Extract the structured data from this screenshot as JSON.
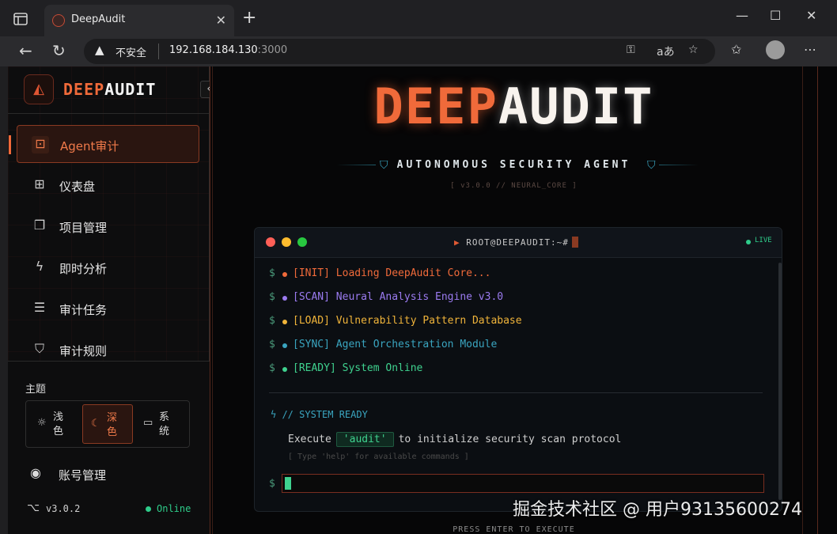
{
  "browser": {
    "tab_title": "DeepAudit",
    "address": {
      "insecure_label": "不安全",
      "host": "192.168.184.130",
      "port": ":3000"
    }
  },
  "sidebar": {
    "brand": {
      "deep": "DEEP",
      "audit": "AUDIT"
    },
    "items": [
      {
        "label": "Agent审计",
        "icon": "robot-icon",
        "active": true
      },
      {
        "label": "仪表盘",
        "icon": "dashboard-icon"
      },
      {
        "label": "项目管理",
        "icon": "folder-icon"
      },
      {
        "label": "即时分析",
        "icon": "lightning-icon"
      },
      {
        "label": "审计任务",
        "icon": "list-icon"
      },
      {
        "label": "审计规则",
        "icon": "shield-icon"
      }
    ],
    "theme": {
      "label": "主题",
      "options": [
        {
          "label": "浅色",
          "icon": "sun-icon"
        },
        {
          "label": "深色",
          "icon": "moon-icon",
          "selected": true
        },
        {
          "label": "系统",
          "icon": "monitor-icon"
        }
      ]
    },
    "account": "账号管理",
    "version": "v3.0.2",
    "status": "Online"
  },
  "hero": {
    "title_deep": "DEEP",
    "title_audit": "AUDIT",
    "subtitle": "AUTONOMOUS SECURITY AGENT",
    "version": "[ v3.0.0 // NEURAL_CORE ]"
  },
  "terminal": {
    "title": "ROOT@DEEPAUDIT:~#",
    "live": "LIVE",
    "prompt": "$",
    "logs": [
      {
        "text": "[INIT] Loading DeepAudit Core...",
        "color": "#f06a3a"
      },
      {
        "text": "[SCAN] Neural Analysis Engine v3.0",
        "color": "#9b7bf0"
      },
      {
        "text": "[LOAD] Vulnerability Pattern Database",
        "color": "#f0b43a"
      },
      {
        "text": "[SYNC] Agent Orchestration Module",
        "color": "#3aa5c0"
      },
      {
        "text": "[READY] System Online",
        "color": "#3fd28f"
      }
    ],
    "ready": "// SYSTEM READY",
    "exec_pre": "Execute",
    "exec_cmd": "'audit'",
    "exec_post": "to initialize security scan protocol",
    "hint": "[ Type 'help' for available commands ]"
  },
  "footer_hint": "PRESS ENTER TO EXECUTE",
  "watermark": "掘金技术社区 @ 用户93135600274"
}
